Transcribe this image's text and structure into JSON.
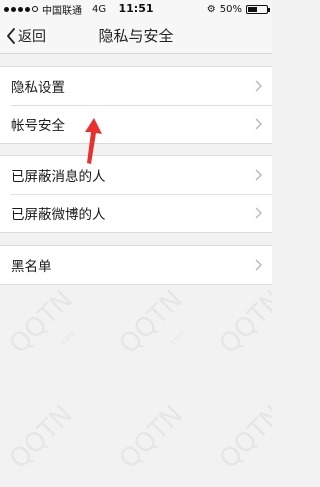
{
  "status_bar": {
    "carrier": "中国联通",
    "network": "4G",
    "time": "11:51",
    "battery_percent": "50%",
    "battery_level": 0.5,
    "signal_bars_filled": 4,
    "signal_bars_total": 5
  },
  "nav": {
    "back_label": "返回",
    "title": "隐私与安全"
  },
  "groups": [
    {
      "items": [
        {
          "label": "隐私设置"
        },
        {
          "label": "帐号安全"
        }
      ]
    },
    {
      "items": [
        {
          "label": "已屏蔽消息的人"
        },
        {
          "label": "已屏蔽微博的人"
        }
      ]
    },
    {
      "items": [
        {
          "label": "黑名单"
        }
      ]
    }
  ],
  "watermark": {
    "brand": "QQTN",
    "suffix": ".com"
  },
  "colors": {
    "background": "#f2f2f2",
    "bar": "#f7f7f7",
    "row": "#ffffff",
    "chevron": "#b8b8b8",
    "annotation_arrow": "#e8302c"
  },
  "icons": {
    "back": "chevron-left-icon",
    "row_chevron": "chevron-right-icon",
    "annotation": "red-arrow-up-icon"
  }
}
